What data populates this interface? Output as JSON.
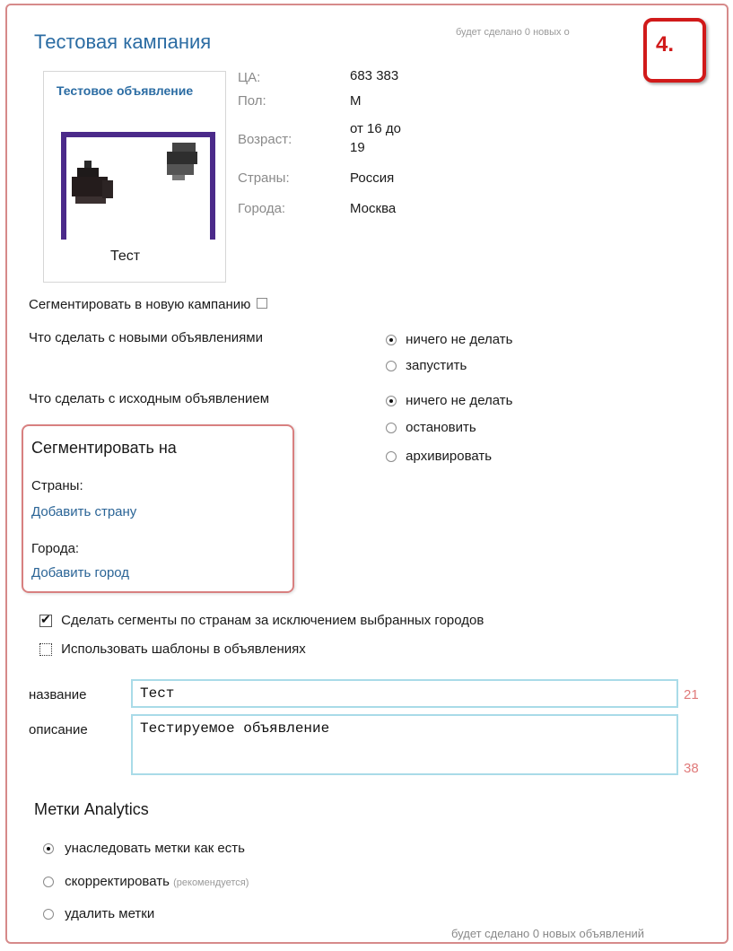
{
  "header": {
    "campaign_title": "Тестовая кампания",
    "top_note": "будет сделано 0 новых о",
    "step_label": "4."
  },
  "ad_preview": {
    "title": "Тестовое объявление",
    "caption": "Тест"
  },
  "targeting": {
    "audience_label": "ЦА:",
    "audience_value": "683 383",
    "gender_label": "Пол:",
    "gender_value": "М",
    "age_label": "Возраст:",
    "age_value_line1": "от 16 до",
    "age_value_line2": "19",
    "countries_label": "Страны:",
    "countries_value": "Россия",
    "cities_label": "Города:",
    "cities_value": "Москва"
  },
  "options": {
    "segment_new_campaign_label": "Сегментировать в новую кампанию",
    "segment_new_campaign_checked": false,
    "new_ads_question": "Что сделать с новыми объявлениями",
    "new_ads_choices": [
      "ничего не делать",
      "запустить"
    ],
    "new_ads_selected": "ничего не делать",
    "source_ad_question": "Что сделать с исходным объявлением",
    "source_ad_choices": [
      "ничего не делать",
      "остановить",
      "архивировать"
    ],
    "source_ad_selected": "ничего не делать"
  },
  "segment_on": {
    "heading": "Сегментировать на",
    "countries_label": "Страны:",
    "add_country_link": "Добавить страну",
    "cities_label": "Города:",
    "add_city_link": "Добавить город"
  },
  "checkboxes": {
    "countries_except_cities_label": "Сделать сегменты по странам за исключением выбранных городов",
    "countries_except_cities_checked": true,
    "use_templates_label": "Использовать шаблоны в объявлениях",
    "use_templates_checked": false
  },
  "form": {
    "name_label": "название",
    "name_value": "Тест",
    "name_counter": "21",
    "description_label": "описание",
    "description_value": "Тестируемое объявление",
    "description_counter": "38"
  },
  "analytics": {
    "heading": "Метки Analytics",
    "choices": [
      {
        "label": "унаследовать метки как есть",
        "note": ""
      },
      {
        "label": "скорректировать",
        "note": "(рекомендуется)"
      },
      {
        "label": "удалить метки",
        "note": ""
      }
    ],
    "selected": "унаследовать метки как есть"
  },
  "footer": {
    "note": "будет сделано 0 новых объявлений"
  },
  "colors": {
    "accent_blue": "#2b6ca3",
    "ad_image_border": "#4b2a8a",
    "highlight_red": "#d11a1a",
    "counter_red": "#e07a7a",
    "field_border": "#a9dbe8"
  }
}
